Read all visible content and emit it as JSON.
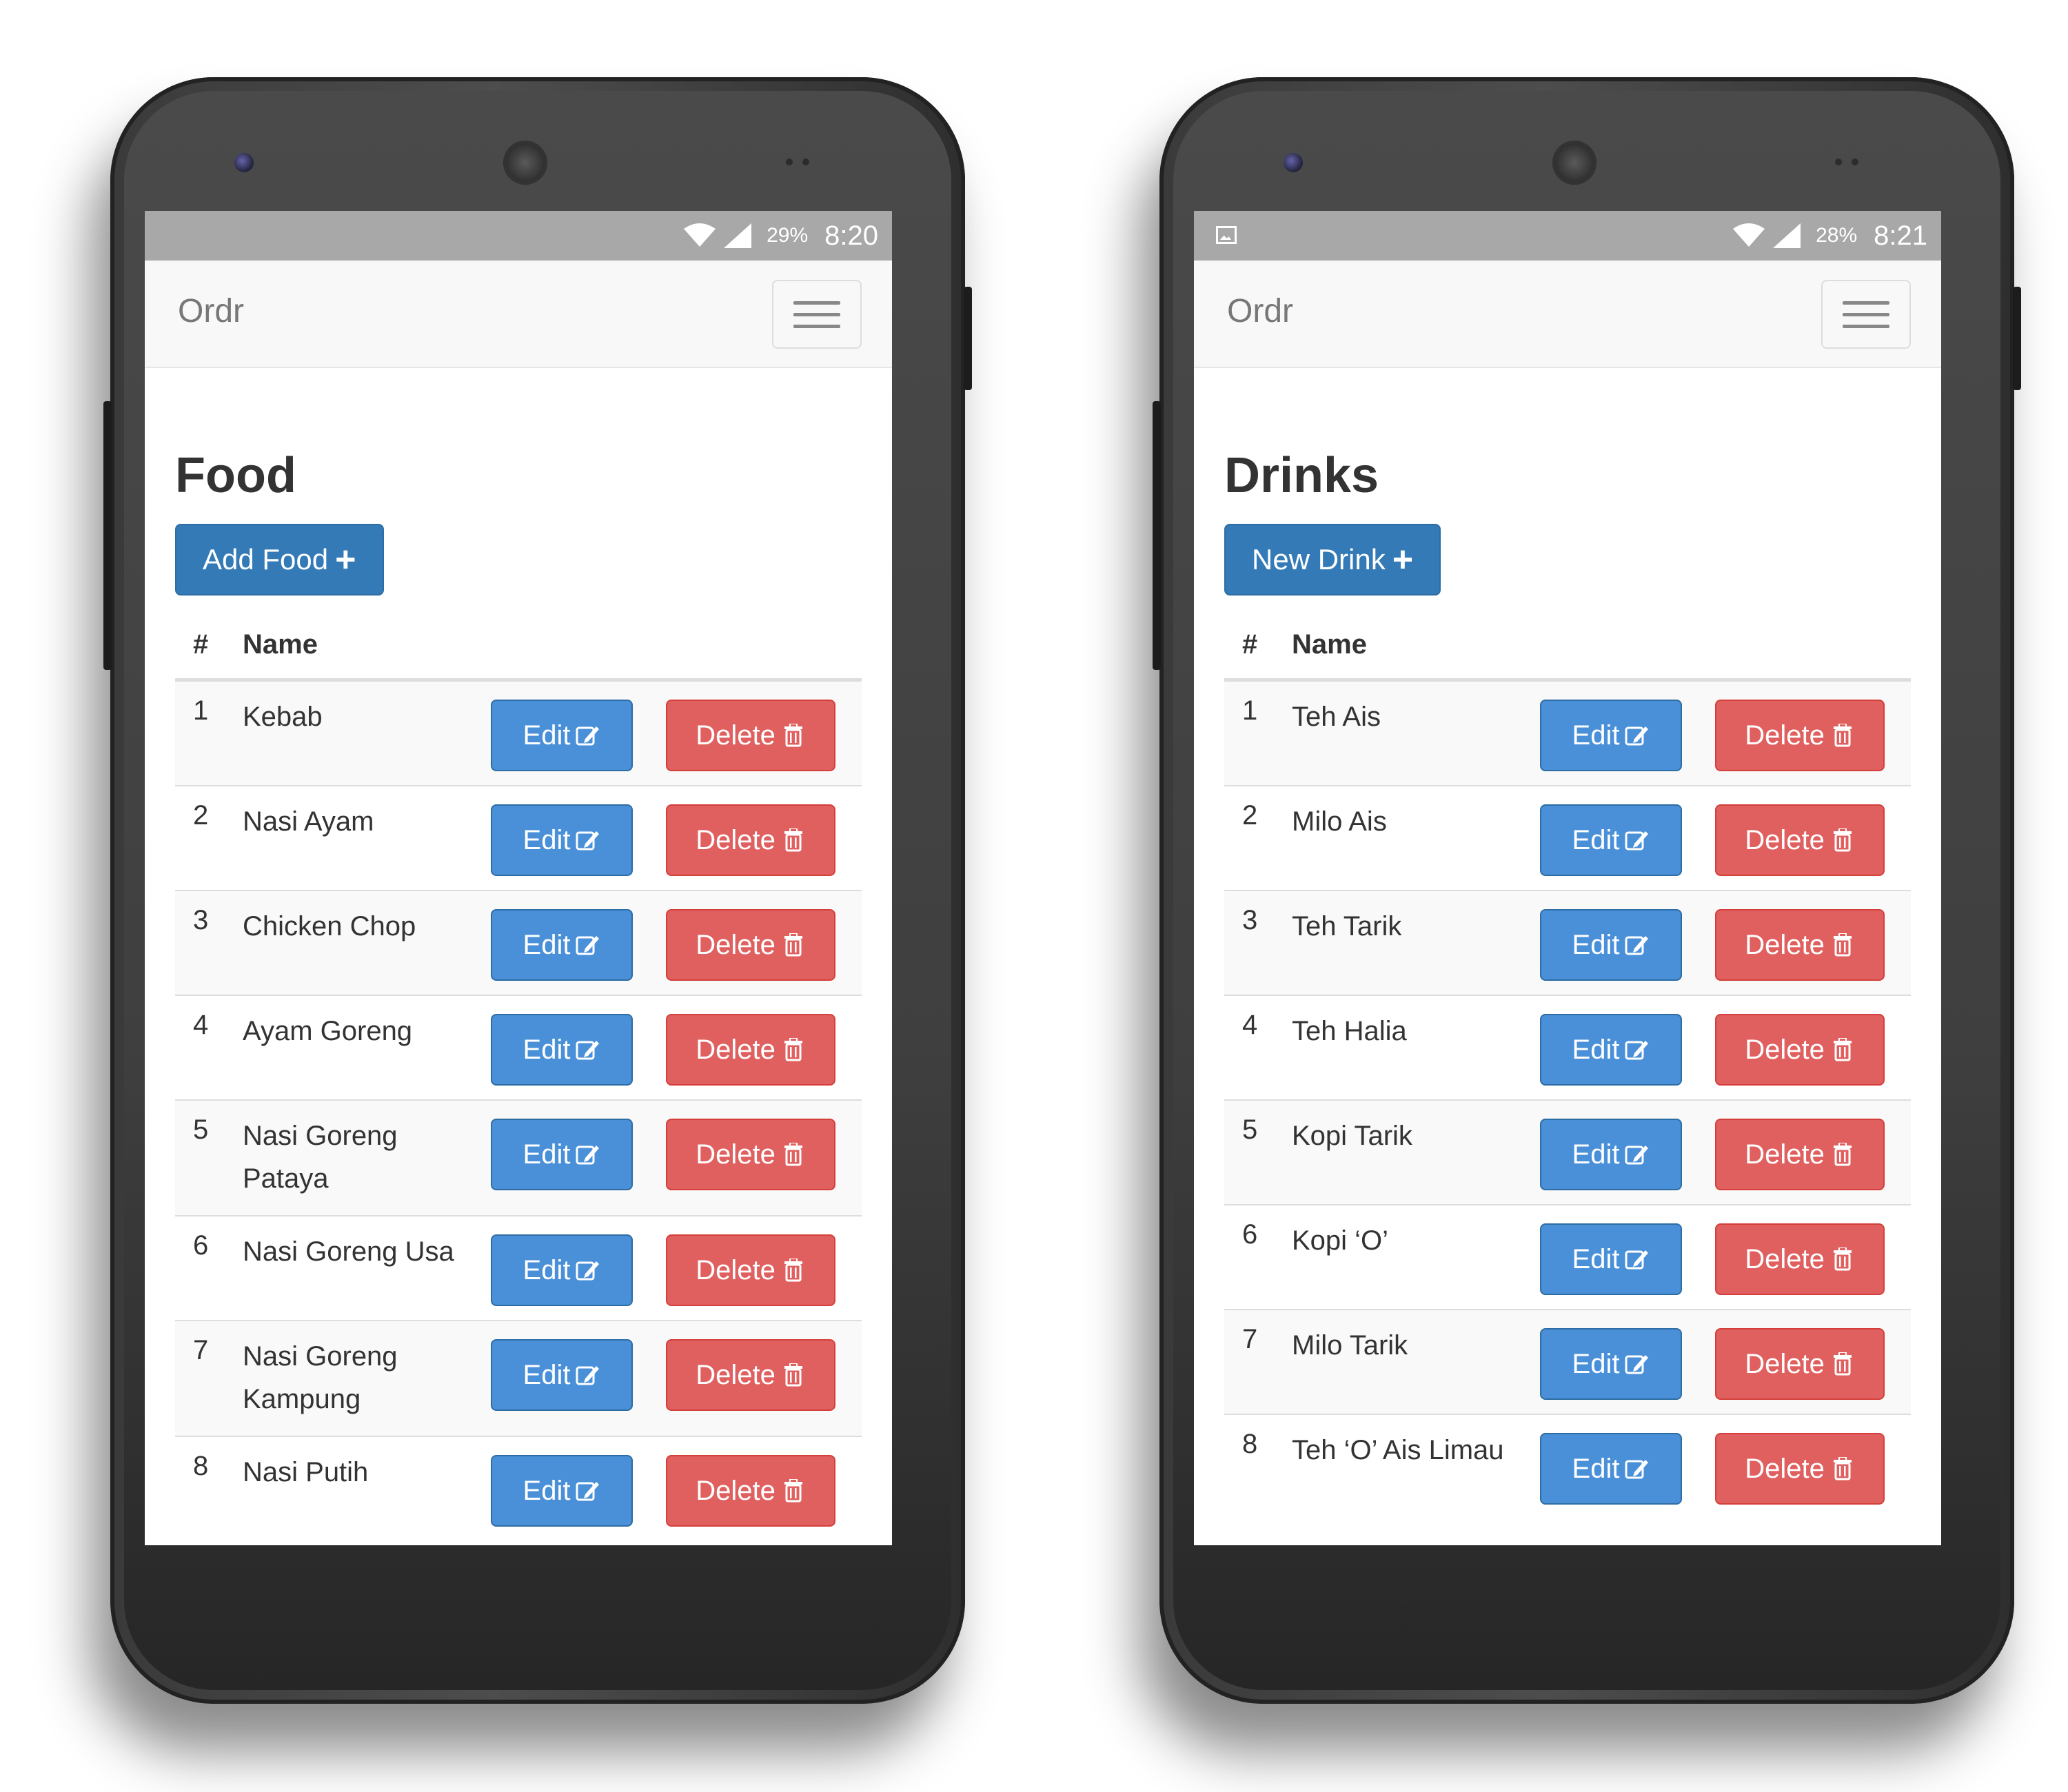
{
  "phones": [
    {
      "status": {
        "battery": "29%",
        "time": "8:20"
      },
      "navbar": {
        "brand": "Ordr"
      },
      "page": {
        "title": "Food",
        "add_label": "Add Food"
      },
      "table": {
        "headers": {
          "num": "#",
          "name": "Name"
        },
        "edit_label": "Edit",
        "delete_label": "Delete",
        "rows": [
          {
            "num": "1",
            "name": "Kebab"
          },
          {
            "num": "2",
            "name": "Nasi Ayam"
          },
          {
            "num": "3",
            "name": "Chicken Chop"
          },
          {
            "num": "4",
            "name": "Ayam Goreng"
          },
          {
            "num": "5",
            "name": "Nasi Goreng Pataya"
          },
          {
            "num": "6",
            "name": "Nasi Goreng Usa"
          },
          {
            "num": "7",
            "name": "Nasi Goreng Kampung"
          },
          {
            "num": "8",
            "name": "Nasi Putih"
          }
        ]
      }
    },
    {
      "status": {
        "battery": "28%",
        "time": "8:21"
      },
      "navbar": {
        "brand": "Ordr"
      },
      "page": {
        "title": "Drinks",
        "add_label": "New Drink"
      },
      "table": {
        "headers": {
          "num": "#",
          "name": "Name"
        },
        "edit_label": "Edit",
        "delete_label": "Delete",
        "rows": [
          {
            "num": "1",
            "name": "Teh Ais"
          },
          {
            "num": "2",
            "name": "Milo Ais"
          },
          {
            "num": "3",
            "name": "Teh Tarik"
          },
          {
            "num": "4",
            "name": "Teh Halia"
          },
          {
            "num": "5",
            "name": "Kopi Tarik"
          },
          {
            "num": "6",
            "name": "Kopi ‘O’"
          },
          {
            "num": "7",
            "name": "Milo Tarik"
          },
          {
            "num": "8",
            "name": "Teh ‘O’ Ais Limau"
          }
        ]
      }
    }
  ]
}
